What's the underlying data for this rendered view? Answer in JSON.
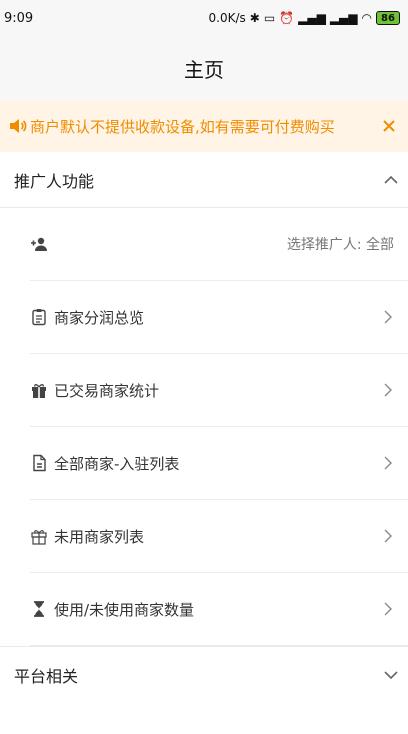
{
  "status_bar": {
    "time": "9:09",
    "speed": "0.0K/s",
    "battery": "86"
  },
  "header": {
    "title": "主页"
  },
  "notice": {
    "text": "商户默认不提供收款设备,如有需要可付费购买"
  },
  "sections": {
    "promoter": {
      "title": "推广人功能"
    },
    "platform": {
      "title": "平台相关"
    }
  },
  "rows": {
    "select_promoter": {
      "value": "选择推广人: 全部"
    },
    "profit_overview": {
      "label": "商家分润总览"
    },
    "traded_stats": {
      "label": "已交易商家统计"
    },
    "all_merchants": {
      "label": "全部商家-入驻列表"
    },
    "unused_merchants": {
      "label": "未用商家列表"
    },
    "usage_count": {
      "label": "使用/未使用商家数量"
    }
  },
  "icons": {
    "notice": "speaker-icon",
    "close": "close-icon",
    "collapse": "chevron-up-icon",
    "expand": "chevron-down-icon",
    "rows": [
      "add-person-icon",
      "clipboard-icon",
      "gift-icon",
      "document-icon",
      "gift-outline-icon",
      "hourglass-icon"
    ]
  },
  "colors": {
    "accent": "#f08c00",
    "notice_bg": "#fff4e6",
    "header_bg": "#f7f7f7",
    "battery": "#6fc13a"
  }
}
